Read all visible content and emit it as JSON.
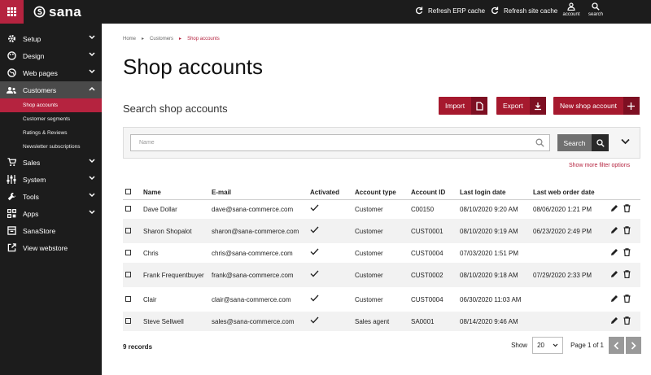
{
  "topbar": {
    "logo_text": "sana",
    "refresh_erp": "Refresh ERP cache",
    "refresh_site": "Refresh site cache",
    "account_label": "account",
    "search_label": "search"
  },
  "sidebar": {
    "items": [
      {
        "label": "Setup",
        "icon": "gear-icon"
      },
      {
        "label": "Design",
        "icon": "palette-icon"
      },
      {
        "label": "Web pages",
        "icon": "globe-icon"
      },
      {
        "label": "Customers",
        "icon": "people-icon"
      },
      {
        "label": "Sales",
        "icon": "cart-icon"
      },
      {
        "label": "System",
        "icon": "sliders-icon"
      },
      {
        "label": "Tools",
        "icon": "wrench-icon"
      },
      {
        "label": "Apps",
        "icon": "apps-icon"
      },
      {
        "label": "SanaStore",
        "icon": "store-icon"
      },
      {
        "label": "View webstore",
        "icon": "external-link-icon"
      }
    ],
    "customer_subitems": [
      "Shop accounts",
      "Customer segments",
      "Ratings & Reviews",
      "Newsletter subscriptions"
    ]
  },
  "breadcrumb": [
    "Home",
    "Customers",
    "Shop accounts"
  ],
  "page": {
    "title": "Shop accounts",
    "subtitle": "Search shop accounts",
    "import_label": "Import",
    "export_label": "Export",
    "new_label": "New shop account",
    "name_placeholder": "Name",
    "search_label": "Search",
    "more_filters": "Show more filter options"
  },
  "table": {
    "headers": [
      "Name",
      "E-mail",
      "Activated",
      "Account type",
      "Account ID",
      "Last login date",
      "Last web order date"
    ],
    "rows": [
      {
        "name": "Dave Dollar",
        "email": "dave@sana-commerce.com",
        "activated": true,
        "type": "Customer",
        "id": "C00150",
        "login": "08/10/2020 9:20 AM",
        "order": "08/06/2020 1:21 PM"
      },
      {
        "name": "Sharon Shopalot",
        "email": "sharon@sana-commerce.com",
        "activated": true,
        "type": "Customer",
        "id": "CUST0001",
        "login": "08/10/2020 9:19 AM",
        "order": "06/23/2020 2:49 PM"
      },
      {
        "name": "Chris",
        "email": "chris@sana-commerce.com",
        "activated": true,
        "type": "Customer",
        "id": "CUST0004",
        "login": "07/03/2020 1:51 PM",
        "order": ""
      },
      {
        "name": "Frank Frequentbuyer",
        "email": "frank@sana-commerce.com",
        "activated": true,
        "type": "Customer",
        "id": "CUST0002",
        "login": "08/10/2020 9:18 AM",
        "order": "07/29/2020 2:33 PM"
      },
      {
        "name": "Clair",
        "email": "clair@sana-commerce.com",
        "activated": true,
        "type": "Customer",
        "id": "CUST0004",
        "login": "06/30/2020 11:03 AM",
        "order": ""
      },
      {
        "name": "Steve Sellwell",
        "email": "sales@sana-commerce.com",
        "activated": true,
        "type": "Sales agent",
        "id": "SA0001",
        "login": "08/14/2020 9:46 AM",
        "order": ""
      }
    ]
  },
  "footer": {
    "records": "9 records",
    "show_label": "Show",
    "page_size": "20",
    "page_info": "Page 1 of 1"
  }
}
